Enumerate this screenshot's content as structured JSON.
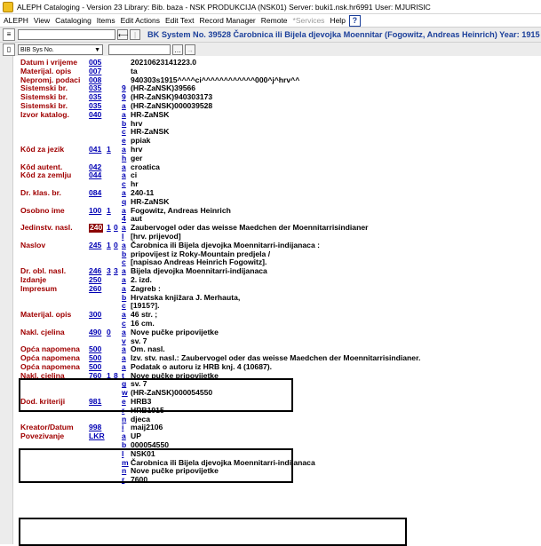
{
  "window": {
    "title": "ALEPH Cataloging - Version 23 Library: Bib. baza - NSK PRODUKCIJA (NSK01) Server: buki1.nsk.hr6991 User: MJURISIC"
  },
  "menu": [
    {
      "label": "ALEPH",
      "disabled": false
    },
    {
      "label": "View",
      "disabled": false
    },
    {
      "label": "Cataloging",
      "disabled": false
    },
    {
      "label": "Items",
      "disabled": false
    },
    {
      "label": "Edit Actions",
      "disabled": false
    },
    {
      "label": "Edit Text",
      "disabled": false
    },
    {
      "label": "Record Manager",
      "disabled": false
    },
    {
      "label": "Remote",
      "disabled": false
    },
    {
      "label": "*Services",
      "disabled": true
    },
    {
      "label": "Help",
      "disabled": false
    }
  ],
  "help_icon": "?",
  "toolbar": {
    "record_title": "BK System No. 39528 Čarobnica ili Bijela djevojka Moennitar (Fogowitz, Andreas Heinrich) Year: 1915",
    "search_select": "BIB Sys No.",
    "search_value": "",
    "nav_forward": "|→",
    "nav_back": "⟵"
  },
  "record_fields": [
    {
      "label": "Datum i vrijeme",
      "tag": "005",
      "ind1": "",
      "ind2": "",
      "sub": "",
      "value": "20210623141223.0"
    },
    {
      "label": "Materijal. opis",
      "tag": "007",
      "ind1": "",
      "ind2": "",
      "sub": "",
      "value": "ta"
    },
    {
      "label": "Nepromj. podaci",
      "tag": "008",
      "ind1": "",
      "ind2": "",
      "sub": "",
      "value": "940303s1915^^^^ci^^^^^^^^^^^^000^j^hrv^^"
    },
    {
      "label": "Sistemski br.",
      "tag": "035",
      "ind1": "",
      "ind2": "",
      "sub": "9",
      "value": "(HR-ZaNSK)39566"
    },
    {
      "label": "Sistemski br.",
      "tag": "035",
      "ind1": "",
      "ind2": "",
      "sub": "9",
      "value": "(HR-ZaNSK)940303173"
    },
    {
      "label": "Sistemski br.",
      "tag": "035",
      "ind1": "",
      "ind2": "",
      "sub": "a",
      "value": "(HR-ZaNSK)000039528"
    },
    {
      "label": "Izvor katalog.",
      "tag": "040",
      "ind1": "",
      "ind2": "",
      "sub": "a",
      "value": "HR-ZaNSK"
    },
    {
      "label": "",
      "tag": "",
      "ind1": "",
      "ind2": "",
      "sub": "b",
      "value": "hrv"
    },
    {
      "label": "",
      "tag": "",
      "ind1": "",
      "ind2": "",
      "sub": "c",
      "value": "HR-ZaNSK"
    },
    {
      "label": "",
      "tag": "",
      "ind1": "",
      "ind2": "",
      "sub": "e",
      "value": "ppiak"
    },
    {
      "label": "Kôd za jezik",
      "tag": "041",
      "ind1": "1",
      "ind2": "",
      "sub": "a",
      "value": "hrv"
    },
    {
      "label": "",
      "tag": "",
      "ind1": "",
      "ind2": "",
      "sub": "h",
      "value": "ger"
    },
    {
      "label": "Kôd autent.",
      "tag": "042",
      "ind1": "",
      "ind2": "",
      "sub": "a",
      "value": "croatica"
    },
    {
      "label": "Kôd za zemlju",
      "tag": "044",
      "ind1": "",
      "ind2": "",
      "sub": "a",
      "value": "ci"
    },
    {
      "label": "",
      "tag": "",
      "ind1": "",
      "ind2": "",
      "sub": "c",
      "value": "hr"
    },
    {
      "label": "Dr. klas. br.",
      "tag": "084",
      "ind1": "",
      "ind2": "",
      "sub": "a",
      "value": "240-11"
    },
    {
      "label": "",
      "tag": "",
      "ind1": "",
      "ind2": "",
      "sub": "q",
      "value": "HR-ZaNSK"
    },
    {
      "label": "Osobno ime",
      "tag": "100",
      "ind1": "1",
      "ind2": "",
      "sub": "a",
      "value": "Fogowitz, Andreas Heinrich"
    },
    {
      "label": "",
      "tag": "",
      "ind1": "",
      "ind2": "",
      "sub": "4",
      "value": "aut"
    },
    {
      "label": "Jedinstv. nasl.",
      "tag": "240",
      "ind1": "1",
      "ind2": "0",
      "sub": "a",
      "value": "Zaubervogel oder das weisse Maedchen der Moennitarrisindianer",
      "highlight": true
    },
    {
      "label": "",
      "tag": "",
      "ind1": "",
      "ind2": "",
      "sub": "l",
      "value": "[hrv. prijevod]"
    },
    {
      "label": "Naslov",
      "tag": "245",
      "ind1": "1",
      "ind2": "0",
      "sub": "a",
      "value": "Čarobnica ili Bijela djevojka Moennitarri-indijanaca :"
    },
    {
      "label": "",
      "tag": "",
      "ind1": "",
      "ind2": "",
      "sub": "b",
      "value": "pripovijest iz Roky-Mountain predjela /"
    },
    {
      "label": "",
      "tag": "",
      "ind1": "",
      "ind2": "",
      "sub": "c",
      "value": "[napisao Andreas Heinrich Fogowitz]."
    },
    {
      "label": "Dr. obl. nasl.",
      "tag": "246",
      "ind1": "3",
      "ind2": "3",
      "sub": "a",
      "value": "Bijela djevojka Moennitarri-indijanaca"
    },
    {
      "label": "Izdanje",
      "tag": "250",
      "ind1": "",
      "ind2": "",
      "sub": "a",
      "value": "2. izd."
    },
    {
      "label": "Impresum",
      "tag": "260",
      "ind1": "",
      "ind2": "",
      "sub": "a",
      "value": "Zagreb :"
    },
    {
      "label": "",
      "tag": "",
      "ind1": "",
      "ind2": "",
      "sub": "b",
      "value": "Hrvatska knjižara J. Merhauta,"
    },
    {
      "label": "",
      "tag": "",
      "ind1": "",
      "ind2": "",
      "sub": "c",
      "value": "[1915?]."
    },
    {
      "label": "Materijal. opis",
      "tag": "300",
      "ind1": "",
      "ind2": "",
      "sub": "a",
      "value": "46 str. ;"
    },
    {
      "label": "",
      "tag": "",
      "ind1": "",
      "ind2": "",
      "sub": "c",
      "value": "16 cm."
    },
    {
      "label": "Nakl. cjelina",
      "tag": "490",
      "ind1": "0",
      "ind2": "",
      "sub": "a",
      "value": "Nove pučke pripovijetke"
    },
    {
      "label": "",
      "tag": "",
      "ind1": "",
      "ind2": "",
      "sub": "v",
      "value": "sv. 7"
    },
    {
      "label": "Opća napomena",
      "tag": "500",
      "ind1": "",
      "ind2": "",
      "sub": "a",
      "value": "Om. nasl."
    },
    {
      "label": "Opća napomena",
      "tag": "500",
      "ind1": "",
      "ind2": "",
      "sub": "a",
      "value": "Izv. stv. nasl.: Zaubervogel oder das weisse Maedchen der Moennitarrisindianer."
    },
    {
      "label": "Opća napomena",
      "tag": "500",
      "ind1": "",
      "ind2": "",
      "sub": "a",
      "value": "Podatak o autoru iz HRB knj. 4 (10687)."
    },
    {
      "label": "Nakl. cjelina",
      "tag": "760",
      "ind1": "1",
      "ind2": "8",
      "sub": "t",
      "value": "Nove pučke pripovijetke"
    },
    {
      "label": "",
      "tag": "",
      "ind1": "",
      "ind2": "",
      "sub": "g",
      "value": "sv. 7"
    },
    {
      "label": "",
      "tag": "",
      "ind1": "",
      "ind2": "",
      "sub": "w",
      "value": "(HR-ZaNSK)000054550"
    },
    {
      "label": "Dod. kriteriji",
      "tag": "981",
      "ind1": "",
      "ind2": "",
      "sub": "e",
      "value": "HRB3"
    },
    {
      "label": "",
      "tag": "",
      "ind1": "",
      "ind2": "",
      "sub": "r",
      "value": "HRB1915"
    },
    {
      "label": "",
      "tag": "",
      "ind1": "",
      "ind2": "",
      "sub": "n",
      "value": "djeca"
    },
    {
      "label": "Kreator/Datum",
      "tag": "998",
      "ind1": "",
      "ind2": "",
      "sub": "i",
      "value": "maij2106"
    },
    {
      "label": "Povezivanje",
      "tag": "LKR",
      "ind1": "",
      "ind2": "",
      "sub": "a",
      "value": "UP"
    },
    {
      "label": "",
      "tag": "",
      "ind1": "",
      "ind2": "",
      "sub": "b",
      "value": "000054550"
    },
    {
      "label": "",
      "tag": "",
      "ind1": "",
      "ind2": "",
      "sub": "l",
      "value": "NSK01"
    },
    {
      "label": "",
      "tag": "",
      "ind1": "",
      "ind2": "",
      "sub": "m",
      "value": "Čarobnica ili Bijela djevojka Moennitarri-indijanaca"
    },
    {
      "label": "",
      "tag": "",
      "ind1": "",
      "ind2": "",
      "sub": "n",
      "value": "Nove pučke pripovijetke"
    },
    {
      "label": "",
      "tag": "",
      "ind1": "",
      "ind2": "",
      "sub": "r",
      "value": "7600"
    }
  ]
}
